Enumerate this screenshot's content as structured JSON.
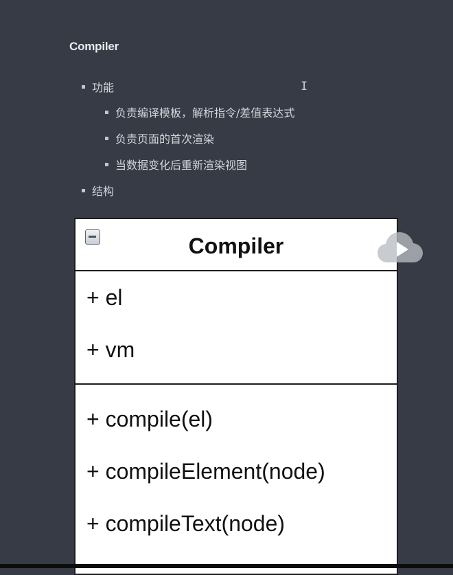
{
  "doc": {
    "heading": "Compiler",
    "bullets": [
      {
        "text": "功能"
      },
      {
        "text": "负责编译模板，解析指令/差值表达式"
      },
      {
        "text": "负责页面的首次渲染"
      },
      {
        "text": "当数据变化后重新渲染视图"
      },
      {
        "text": "结构"
      }
    ],
    "cursor_glyph": "I"
  },
  "uml": {
    "class_name": "Compiler",
    "attributes": [
      "+ el",
      "+ vm"
    ],
    "methods": [
      "+ compile(el)",
      "+ compileElement(node)",
      "+ compileText(node)"
    ]
  },
  "overlay": {
    "icon": "cloud-play-icon"
  },
  "colors": {
    "background": "#363b45",
    "text": "#d3d6db",
    "uml_border": "#1c1c1c"
  }
}
